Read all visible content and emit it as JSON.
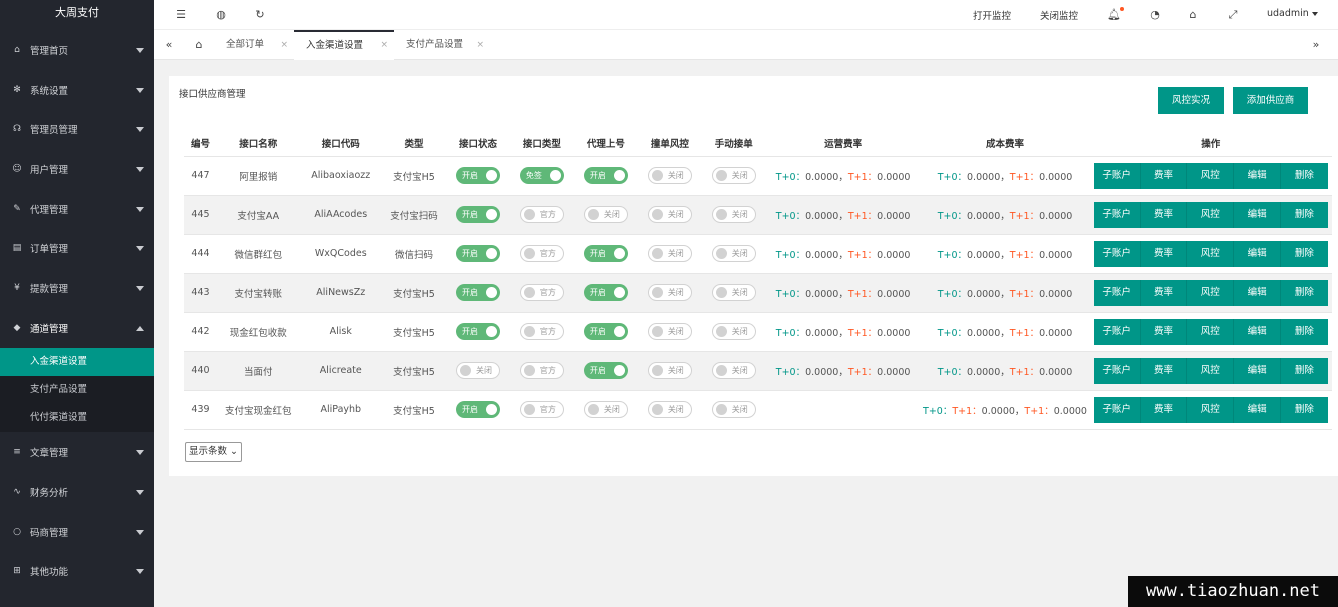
{
  "app": {
    "title": "大周支付"
  },
  "sidebar": {
    "items": [
      {
        "label": "管理首页",
        "icon": "home-icon",
        "glyph": "⌂"
      },
      {
        "label": "系统设置",
        "icon": "gear-icon",
        "glyph": "✻"
      },
      {
        "label": "管理员管理",
        "icon": "headset-icon",
        "glyph": "☊"
      },
      {
        "label": "用户管理",
        "icon": "users-icon",
        "glyph": "☺"
      },
      {
        "label": "代理管理",
        "icon": "agent-icon",
        "glyph": "✎"
      },
      {
        "label": "订单管理",
        "icon": "order-icon",
        "glyph": "▤"
      },
      {
        "label": "提款管理",
        "icon": "money-icon",
        "glyph": "¥"
      },
      {
        "label": "通道管理",
        "icon": "diamond-icon",
        "glyph": "◆"
      }
    ],
    "sub_items": [
      {
        "label": "入金渠道设置",
        "active": true
      },
      {
        "label": "支付产品设置",
        "active": false
      },
      {
        "label": "代付渠道设置",
        "active": false
      }
    ],
    "items_after": [
      {
        "label": "文章管理",
        "icon": "article-icon",
        "glyph": "≡"
      },
      {
        "label": "财务分析",
        "icon": "chart-icon",
        "glyph": "∿"
      },
      {
        "label": "码商管理",
        "icon": "merchant-icon",
        "glyph": "○"
      },
      {
        "label": "其他功能",
        "icon": "other-icon",
        "glyph": "⊞"
      }
    ]
  },
  "topbar": {
    "open_monitor": "打开监控",
    "close_monitor": "关闭监控",
    "username": "udadmin"
  },
  "tabs": [
    {
      "label": "全部订单",
      "active": false
    },
    {
      "label": "入金渠道设置",
      "active": true
    },
    {
      "label": "支付产品设置",
      "active": false
    }
  ],
  "card": {
    "title": "接口供应商管理",
    "risk_button": "风控实况",
    "add_button": "添加供应商",
    "page_size": "显示条数"
  },
  "table": {
    "headers": [
      "编号",
      "接口名称",
      "接口代码",
      "类型",
      "接口状态",
      "接口类型",
      "代理上号",
      "撞单风控",
      "手动接单",
      "运营费率",
      "成本费率",
      "操作"
    ],
    "ops": [
      "子账户",
      "费率",
      "风控",
      "编辑",
      "删除"
    ],
    "rows": [
      {
        "id": "447",
        "name": "阿里报销",
        "code": "Alibaoxiaozz",
        "type": "支付宝H5",
        "status": "开启",
        "status_on": true,
        "itype": "免签",
        "itype_on": true,
        "agent": "开启",
        "agent_on": true,
        "risk": "关闭",
        "manual": "关闭",
        "op_rate": [
          "T+0：",
          "0.0000，",
          "T+1：",
          "0.0000"
        ],
        "cost_rate": [
          "T+0：",
          "0.0000，",
          "T+1：",
          "0.0000"
        ]
      },
      {
        "id": "445",
        "name": "支付宝AA",
        "code": "AliAAcodes",
        "type": "支付宝扫码",
        "status": "开启",
        "status_on": true,
        "itype": "官方",
        "itype_on": false,
        "agent": "关闭",
        "agent_on": false,
        "risk": "关闭",
        "manual": "关闭",
        "op_rate": [
          "T+0：",
          "0.0000，",
          "T+1：",
          "0.0000"
        ],
        "cost_rate": [
          "T+0：",
          "0.0000，",
          "T+1：",
          "0.0000"
        ]
      },
      {
        "id": "444",
        "name": "微信群红包",
        "code": "WxQCodes",
        "type": "微信扫码",
        "status": "开启",
        "status_on": true,
        "itype": "官方",
        "itype_on": false,
        "agent": "开启",
        "agent_on": true,
        "risk": "关闭",
        "manual": "关闭",
        "op_rate": [
          "T+0：",
          "0.0000，",
          "T+1：",
          "0.0000"
        ],
        "cost_rate": [
          "T+0：",
          "0.0000，",
          "T+1：",
          "0.0000"
        ]
      },
      {
        "id": "443",
        "name": "支付宝转账",
        "code": "AliNewsZz",
        "type": "支付宝H5",
        "status": "开启",
        "status_on": true,
        "itype": "官方",
        "itype_on": false,
        "agent": "开启",
        "agent_on": true,
        "risk": "关闭",
        "manual": "关闭",
        "op_rate": [
          "T+0：",
          "0.0000，",
          "T+1：",
          "0.0000"
        ],
        "cost_rate": [
          "T+0：",
          "0.0000，",
          "T+1：",
          "0.0000"
        ]
      },
      {
        "id": "442",
        "name": "现金红包收款",
        "code": "Alisk",
        "type": "支付宝H5",
        "status": "开启",
        "status_on": true,
        "itype": "官方",
        "itype_on": false,
        "agent": "开启",
        "agent_on": true,
        "risk": "关闭",
        "manual": "关闭",
        "op_rate": [
          "T+0：",
          "0.0000，",
          "T+1：",
          "0.0000"
        ],
        "cost_rate": [
          "T+0：",
          "0.0000，",
          "T+1：",
          "0.0000"
        ]
      },
      {
        "id": "440",
        "name": "当面付",
        "code": "Alicreate",
        "type": "支付宝H5",
        "status": "关闭",
        "status_on": false,
        "itype": "官方",
        "itype_on": false,
        "agent": "开启",
        "agent_on": true,
        "risk": "关闭",
        "manual": "关闭",
        "op_rate": [
          "T+0：",
          "0.0000，",
          "T+1：",
          "0.0000"
        ],
        "cost_rate": [
          "T+0：",
          "0.0000，",
          "T+1：",
          "0.0000"
        ]
      },
      {
        "id": "439",
        "name": "支付宝现金红包",
        "code": "AliPayhb",
        "type": "支付宝H5",
        "status": "开启",
        "status_on": true,
        "itype": "官方",
        "itype_on": false,
        "agent": "关闭",
        "agent_on": false,
        "risk": "关闭",
        "manual": "关闭",
        "op_rate": [
          "",
          "",
          "",
          ""
        ],
        "cost_rate": [
          "T+0：",
          "T+1：",
          "0.0000，",
          "T+1：",
          "0.0000"
        ]
      }
    ]
  },
  "watermark": "www.tiaozhuan.net"
}
